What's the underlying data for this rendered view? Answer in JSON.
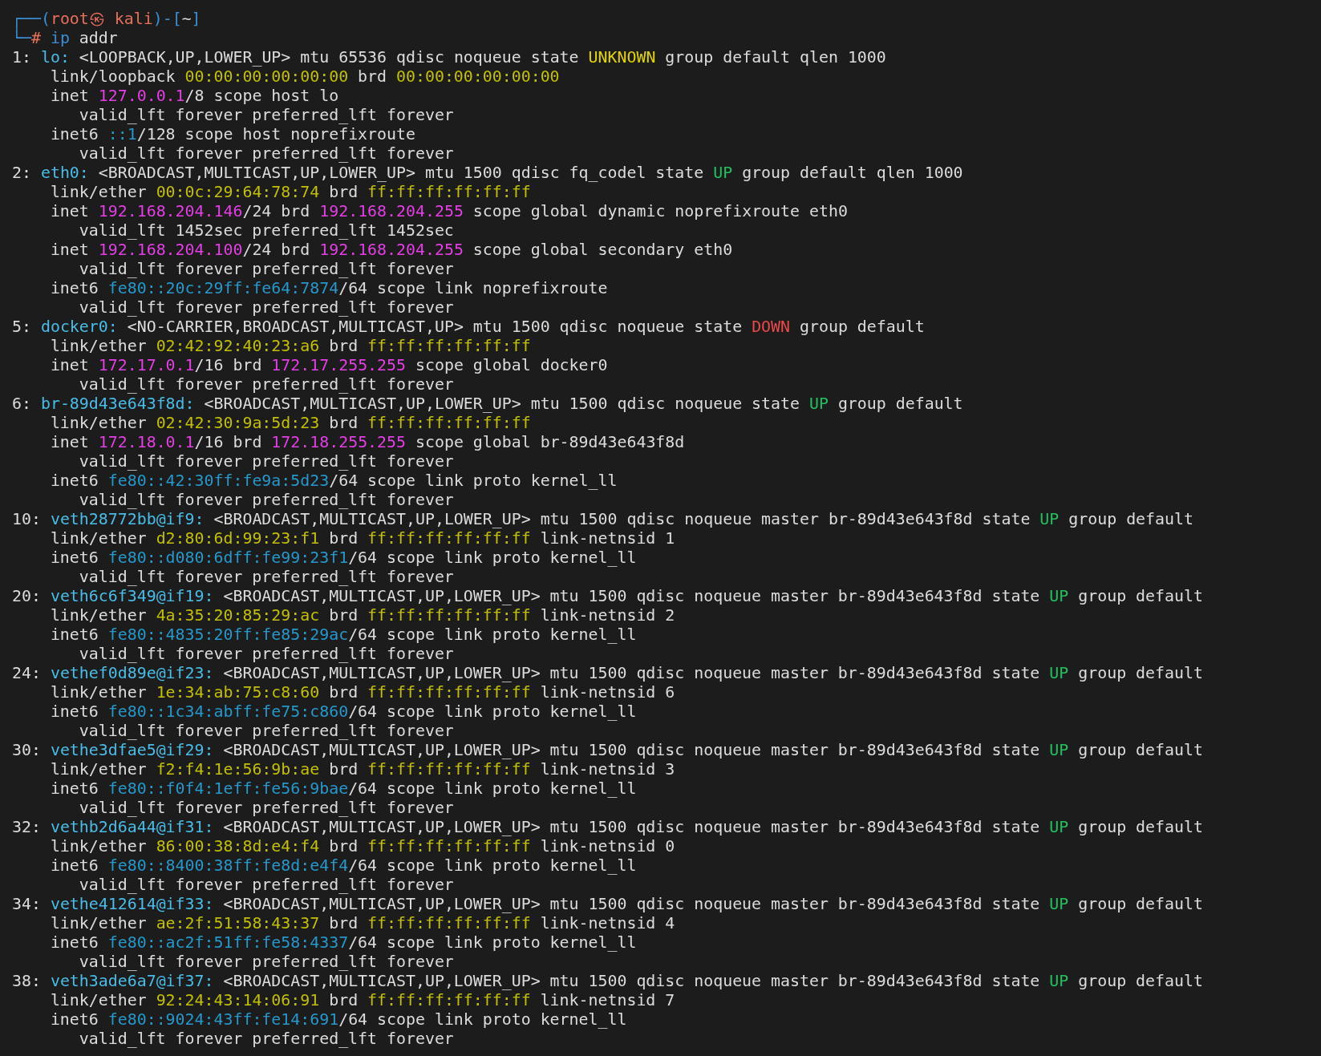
{
  "terminal": {
    "lines": [
      {
        "kind": "prompt",
        "segments": [
          {
            "text": "┌──(",
            "color": "#3a8fd6"
          },
          {
            "text": "root㉿ kali",
            "color": "#e8705a"
          },
          {
            "text": ")-[",
            "color": "#3a8fd6"
          },
          {
            "text": "~"
          },
          {
            "text": "]",
            "color": "#3a8fd6"
          }
        ]
      },
      {
        "kind": "prompt",
        "segments": [
          {
            "text": "└─",
            "color": "#3a8fd6"
          },
          {
            "text": "#",
            "color": "#e8705a"
          },
          {
            "text": " ip",
            "color": "#3a8fd6"
          },
          {
            "text": " addr"
          }
        ]
      },
      {
        "kind": "iface",
        "segments": [
          {
            "text": "1: "
          },
          {
            "text": "lo:",
            "color": "#48bde8"
          },
          {
            "text": " <LOOPBACK,UP,LOWER_UP> mtu 65536 qdisc noqueue state "
          },
          {
            "text": "UNKNOWN",
            "color": "#e2d400"
          },
          {
            "text": " group default qlen 1000"
          }
        ]
      },
      {
        "kind": "attr",
        "segments": [
          {
            "text": "link/loopback "
          },
          {
            "text": "00:00:00:00:00:00",
            "color": "#c2c000"
          },
          {
            "text": " brd "
          },
          {
            "text": "00:00:00:00:00:00",
            "color": "#c2c000"
          }
        ]
      },
      {
        "kind": "attr",
        "segments": [
          {
            "text": "inet "
          },
          {
            "text": "127.0.0.1",
            "color": "#e43ee4"
          },
          {
            "text": "/8 scope host lo"
          }
        ]
      },
      {
        "kind": "lft",
        "segments": [
          {
            "text": "valid_lft forever preferred_lft forever"
          }
        ]
      },
      {
        "kind": "attr",
        "segments": [
          {
            "text": "inet6 "
          },
          {
            "text": "::1",
            "color": "#2598cc"
          },
          {
            "text": "/128 scope host noprefixroute"
          }
        ]
      },
      {
        "kind": "lft",
        "segments": [
          {
            "text": "valid_lft forever preferred_lft forever"
          }
        ]
      },
      {
        "kind": "iface",
        "segments": [
          {
            "text": "2: "
          },
          {
            "text": "eth0:",
            "color": "#48bde8"
          },
          {
            "text": " <BROADCAST,MULTICAST,UP,LOWER_UP> mtu 1500 qdisc fq_codel state "
          },
          {
            "text": "UP",
            "color": "#22c060"
          },
          {
            "text": " group default qlen 1000"
          }
        ]
      },
      {
        "kind": "attr",
        "segments": [
          {
            "text": "link/ether "
          },
          {
            "text": "00:0c:29:64:78:74",
            "color": "#c2c000"
          },
          {
            "text": " brd "
          },
          {
            "text": "ff:ff:ff:ff:ff:ff",
            "color": "#c2c000"
          }
        ]
      },
      {
        "kind": "attr",
        "segments": [
          {
            "text": "inet "
          },
          {
            "text": "192.168.204.146",
            "color": "#e43ee4"
          },
          {
            "text": "/24 brd "
          },
          {
            "text": "192.168.204.255",
            "color": "#e43ee4"
          },
          {
            "text": " scope global dynamic noprefixroute eth0"
          }
        ]
      },
      {
        "kind": "lft",
        "segments": [
          {
            "text": "valid_lft 1452sec preferred_lft 1452sec"
          }
        ]
      },
      {
        "kind": "attr",
        "segments": [
          {
            "text": "inet "
          },
          {
            "text": "192.168.204.100",
            "color": "#e43ee4"
          },
          {
            "text": "/24 brd "
          },
          {
            "text": "192.168.204.255",
            "color": "#e43ee4"
          },
          {
            "text": " scope global secondary eth0"
          }
        ]
      },
      {
        "kind": "lft",
        "segments": [
          {
            "text": "valid_lft forever preferred_lft forever"
          }
        ]
      },
      {
        "kind": "attr",
        "segments": [
          {
            "text": "inet6 "
          },
          {
            "text": "fe80::20c:29ff:fe64:7874",
            "color": "#2598cc"
          },
          {
            "text": "/64 scope link noprefixroute"
          }
        ]
      },
      {
        "kind": "lft",
        "segments": [
          {
            "text": "valid_lft forever preferred_lft forever"
          }
        ]
      },
      {
        "kind": "iface",
        "segments": [
          {
            "text": "5: "
          },
          {
            "text": "docker0:",
            "color": "#48bde8"
          },
          {
            "text": " <NO-CARRIER,BROADCAST,MULTICAST,UP> mtu 1500 qdisc noqueue state "
          },
          {
            "text": "DOWN",
            "color": "#ea4a4a"
          },
          {
            "text": " group default"
          }
        ]
      },
      {
        "kind": "attr",
        "segments": [
          {
            "text": "link/ether "
          },
          {
            "text": "02:42:92:40:23:a6",
            "color": "#c2c000"
          },
          {
            "text": " brd "
          },
          {
            "text": "ff:ff:ff:ff:ff:ff",
            "color": "#c2c000"
          }
        ]
      },
      {
        "kind": "attr",
        "segments": [
          {
            "text": "inet "
          },
          {
            "text": "172.17.0.1",
            "color": "#e43ee4"
          },
          {
            "text": "/16 brd "
          },
          {
            "text": "172.17.255.255",
            "color": "#e43ee4"
          },
          {
            "text": " scope global docker0"
          }
        ]
      },
      {
        "kind": "lft",
        "segments": [
          {
            "text": "valid_lft forever preferred_lft forever"
          }
        ]
      },
      {
        "kind": "iface",
        "segments": [
          {
            "text": "6: "
          },
          {
            "text": "br-89d43e643f8d:",
            "color": "#48bde8"
          },
          {
            "text": " <BROADCAST,MULTICAST,UP,LOWER_UP> mtu 1500 qdisc noqueue state "
          },
          {
            "text": "UP",
            "color": "#22c060"
          },
          {
            "text": " group default"
          }
        ]
      },
      {
        "kind": "attr",
        "segments": [
          {
            "text": "link/ether "
          },
          {
            "text": "02:42:30:9a:5d:23",
            "color": "#c2c000"
          },
          {
            "text": " brd "
          },
          {
            "text": "ff:ff:ff:ff:ff:ff",
            "color": "#c2c000"
          }
        ]
      },
      {
        "kind": "attr",
        "segments": [
          {
            "text": "inet "
          },
          {
            "text": "172.18.0.1",
            "color": "#e43ee4"
          },
          {
            "text": "/16 brd "
          },
          {
            "text": "172.18.255.255",
            "color": "#e43ee4"
          },
          {
            "text": " scope global br-89d43e643f8d"
          }
        ]
      },
      {
        "kind": "lft",
        "segments": [
          {
            "text": "valid_lft forever preferred_lft forever"
          }
        ]
      },
      {
        "kind": "attr",
        "segments": [
          {
            "text": "inet6 "
          },
          {
            "text": "fe80::42:30ff:fe9a:5d23",
            "color": "#2598cc"
          },
          {
            "text": "/64 scope link proto kernel_ll"
          }
        ]
      },
      {
        "kind": "lft",
        "segments": [
          {
            "text": "valid_lft forever preferred_lft forever"
          }
        ]
      },
      {
        "kind": "iface",
        "segments": [
          {
            "text": "10: "
          },
          {
            "text": "veth28772bb@if9:",
            "color": "#48bde8"
          },
          {
            "text": " <BROADCAST,MULTICAST,UP,LOWER_UP> mtu 1500 qdisc noqueue master br-89d43e643f8d state "
          },
          {
            "text": "UP",
            "color": "#22c060"
          },
          {
            "text": " group default"
          }
        ]
      },
      {
        "kind": "attr",
        "segments": [
          {
            "text": "link/ether "
          },
          {
            "text": "d2:80:6d:99:23:f1",
            "color": "#c2c000"
          },
          {
            "text": " brd "
          },
          {
            "text": "ff:ff:ff:ff:ff:ff",
            "color": "#c2c000"
          },
          {
            "text": " link-netnsid 1"
          }
        ]
      },
      {
        "kind": "attr",
        "segments": [
          {
            "text": "inet6 "
          },
          {
            "text": "fe80::d080:6dff:fe99:23f1",
            "color": "#2598cc"
          },
          {
            "text": "/64 scope link proto kernel_ll"
          }
        ]
      },
      {
        "kind": "lft",
        "segments": [
          {
            "text": "valid_lft forever preferred_lft forever"
          }
        ]
      },
      {
        "kind": "iface",
        "segments": [
          {
            "text": "20: "
          },
          {
            "text": "veth6c6f349@if19:",
            "color": "#48bde8"
          },
          {
            "text": " <BROADCAST,MULTICAST,UP,LOWER_UP> mtu 1500 qdisc noqueue master br-89d43e643f8d state "
          },
          {
            "text": "UP",
            "color": "#22c060"
          },
          {
            "text": " group default"
          }
        ]
      },
      {
        "kind": "attr",
        "segments": [
          {
            "text": "link/ether "
          },
          {
            "text": "4a:35:20:85:29:ac",
            "color": "#c2c000"
          },
          {
            "text": " brd "
          },
          {
            "text": "ff:ff:ff:ff:ff:ff",
            "color": "#c2c000"
          },
          {
            "text": " link-netnsid 2"
          }
        ]
      },
      {
        "kind": "attr",
        "segments": [
          {
            "text": "inet6 "
          },
          {
            "text": "fe80::4835:20ff:fe85:29ac",
            "color": "#2598cc"
          },
          {
            "text": "/64 scope link proto kernel_ll"
          }
        ]
      },
      {
        "kind": "lft",
        "segments": [
          {
            "text": "valid_lft forever preferred_lft forever"
          }
        ]
      },
      {
        "kind": "iface",
        "segments": [
          {
            "text": "24: "
          },
          {
            "text": "vethef0d89e@if23:",
            "color": "#48bde8"
          },
          {
            "text": " <BROADCAST,MULTICAST,UP,LOWER_UP> mtu 1500 qdisc noqueue master br-89d43e643f8d state "
          },
          {
            "text": "UP",
            "color": "#22c060"
          },
          {
            "text": " group default"
          }
        ]
      },
      {
        "kind": "attr",
        "segments": [
          {
            "text": "link/ether "
          },
          {
            "text": "1e:34:ab:75:c8:60",
            "color": "#c2c000"
          },
          {
            "text": " brd "
          },
          {
            "text": "ff:ff:ff:ff:ff:ff",
            "color": "#c2c000"
          },
          {
            "text": " link-netnsid 6"
          }
        ]
      },
      {
        "kind": "attr",
        "segments": [
          {
            "text": "inet6 "
          },
          {
            "text": "fe80::1c34:abff:fe75:c860",
            "color": "#2598cc"
          },
          {
            "text": "/64 scope link proto kernel_ll"
          }
        ]
      },
      {
        "kind": "lft",
        "segments": [
          {
            "text": "valid_lft forever preferred_lft forever"
          }
        ]
      },
      {
        "kind": "iface",
        "segments": [
          {
            "text": "30: "
          },
          {
            "text": "vethe3dfae5@if29:",
            "color": "#48bde8"
          },
          {
            "text": " <BROADCAST,MULTICAST,UP,LOWER_UP> mtu 1500 qdisc noqueue master br-89d43e643f8d state "
          },
          {
            "text": "UP",
            "color": "#22c060"
          },
          {
            "text": " group default"
          }
        ]
      },
      {
        "kind": "attr",
        "segments": [
          {
            "text": "link/ether "
          },
          {
            "text": "f2:f4:1e:56:9b:ae",
            "color": "#c2c000"
          },
          {
            "text": " brd "
          },
          {
            "text": "ff:ff:ff:ff:ff:ff",
            "color": "#c2c000"
          },
          {
            "text": " link-netnsid 3"
          }
        ]
      },
      {
        "kind": "attr",
        "segments": [
          {
            "text": "inet6 "
          },
          {
            "text": "fe80::f0f4:1eff:fe56:9bae",
            "color": "#2598cc"
          },
          {
            "text": "/64 scope link proto kernel_ll"
          }
        ]
      },
      {
        "kind": "lft",
        "segments": [
          {
            "text": "valid_lft forever preferred_lft forever"
          }
        ]
      },
      {
        "kind": "iface",
        "segments": [
          {
            "text": "32: "
          },
          {
            "text": "vethb2d6a44@if31:",
            "color": "#48bde8"
          },
          {
            "text": " <BROADCAST,MULTICAST,UP,LOWER_UP> mtu 1500 qdisc noqueue master br-89d43e643f8d state "
          },
          {
            "text": "UP",
            "color": "#22c060"
          },
          {
            "text": " group default"
          }
        ]
      },
      {
        "kind": "attr",
        "segments": [
          {
            "text": "link/ether "
          },
          {
            "text": "86:00:38:8d:e4:f4",
            "color": "#c2c000"
          },
          {
            "text": " brd "
          },
          {
            "text": "ff:ff:ff:ff:ff:ff",
            "color": "#c2c000"
          },
          {
            "text": " link-netnsid 0"
          }
        ]
      },
      {
        "kind": "attr",
        "segments": [
          {
            "text": "inet6 "
          },
          {
            "text": "fe80::8400:38ff:fe8d:e4f4",
            "color": "#2598cc"
          },
          {
            "text": "/64 scope link proto kernel_ll"
          }
        ]
      },
      {
        "kind": "lft",
        "segments": [
          {
            "text": "valid_lft forever preferred_lft forever"
          }
        ]
      },
      {
        "kind": "iface",
        "segments": [
          {
            "text": "34: "
          },
          {
            "text": "vethe412614@if33:",
            "color": "#48bde8"
          },
          {
            "text": " <BROADCAST,MULTICAST,UP,LOWER_UP> mtu 1500 qdisc noqueue master br-89d43e643f8d state "
          },
          {
            "text": "UP",
            "color": "#22c060"
          },
          {
            "text": " group default"
          }
        ]
      },
      {
        "kind": "attr",
        "segments": [
          {
            "text": "link/ether "
          },
          {
            "text": "ae:2f:51:58:43:37",
            "color": "#c2c000"
          },
          {
            "text": " brd "
          },
          {
            "text": "ff:ff:ff:ff:ff:ff",
            "color": "#c2c000"
          },
          {
            "text": " link-netnsid 4"
          }
        ]
      },
      {
        "kind": "attr",
        "segments": [
          {
            "text": "inet6 "
          },
          {
            "text": "fe80::ac2f:51ff:fe58:4337",
            "color": "#2598cc"
          },
          {
            "text": "/64 scope link proto kernel_ll"
          }
        ]
      },
      {
        "kind": "lft",
        "segments": [
          {
            "text": "valid_lft forever preferred_lft forever"
          }
        ]
      },
      {
        "kind": "iface",
        "segments": [
          {
            "text": "38: "
          },
          {
            "text": "veth3ade6a7@if37:",
            "color": "#48bde8"
          },
          {
            "text": " <BROADCAST,MULTICAST,UP,LOWER_UP> mtu 1500 qdisc noqueue master br-89d43e643f8d state "
          },
          {
            "text": "UP",
            "color": "#22c060"
          },
          {
            "text": " group default"
          }
        ]
      },
      {
        "kind": "attr",
        "segments": [
          {
            "text": "link/ether "
          },
          {
            "text": "92:24:43:14:06:91",
            "color": "#c2c000"
          },
          {
            "text": " brd "
          },
          {
            "text": "ff:ff:ff:ff:ff:ff",
            "color": "#c2c000"
          },
          {
            "text": " link-netnsid 7"
          }
        ]
      },
      {
        "kind": "attr",
        "segments": [
          {
            "text": "inet6 "
          },
          {
            "text": "fe80::9024:43ff:fe14:691",
            "color": "#2598cc"
          },
          {
            "text": "/64 scope link proto kernel_ll"
          }
        ]
      },
      {
        "kind": "lft",
        "segments": [
          {
            "text": "valid_lft forever preferred_lft forever"
          }
        ]
      }
    ]
  }
}
